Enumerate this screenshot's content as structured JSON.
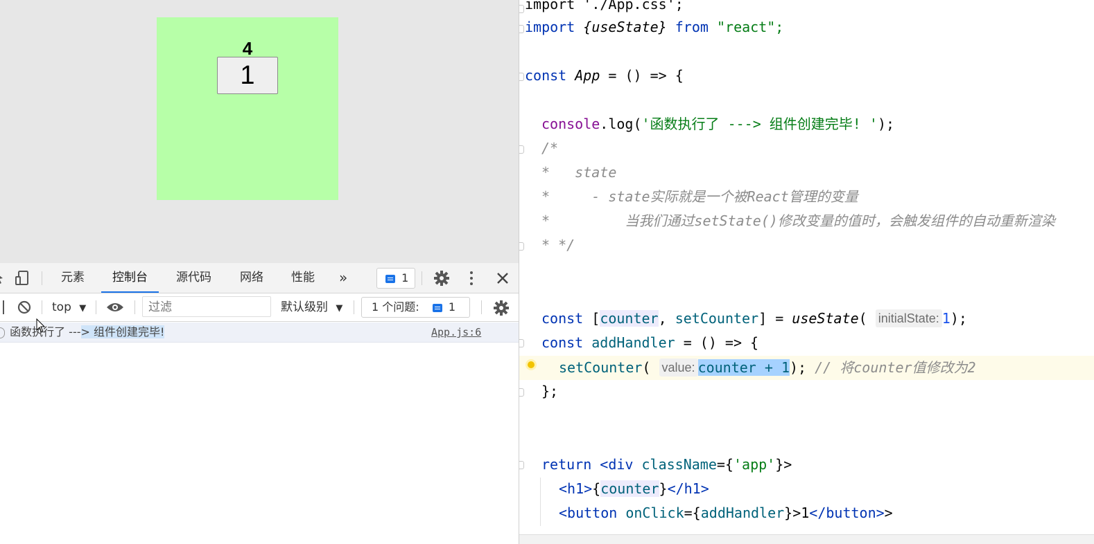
{
  "viewport": {
    "counter_text": "4",
    "button_label": "1"
  },
  "devtools": {
    "tabs": [
      "元素",
      "控制台",
      "源代码",
      "网络",
      "性能"
    ],
    "more_tabs": "»",
    "issues_badge_count": "1",
    "toolbar": {
      "context": "top",
      "filter_placeholder": "过滤",
      "level": "默认级别",
      "issues_label": "1 个问题:",
      "issues_count": "1"
    },
    "log": {
      "text_start": "函数执行了 ---",
      "text_highlight": "> 组件创建完毕!",
      "source": "App.js:6"
    }
  },
  "editor": {
    "line1": "import './App.css';",
    "line2_kw": "import",
    "line2_name": "{useState}",
    "line2_from": "from",
    "line2_str": "\"react\";",
    "const_kw": "const",
    "app_name": "App",
    "app_rest": " = () => {",
    "console": "console",
    "log": ".log(",
    "log_str": "'函数执行了 ---> 组件创建完毕! '",
    "log_end": ");",
    "c1": "/*",
    "c2": "*   state",
    "c3": "*     - state实际就是一个被React管理的变量",
    "c4": "*         当我们通过setState()修改变量的值时，会触发组件的自动重新渲染",
    "c5": "* */",
    "counter": "counter",
    "setCounter": "setCounter",
    "useState": "useState",
    "hint_initial": "initialState:",
    "one": "1",
    "addHandler": "addHandler",
    "arrow": " = () => {",
    "hint_value": "value:",
    "inc": "counter + 1",
    "comment_set": "// 将counter值修改为2",
    "close_brace": "};",
    "return_kw": "return",
    "div_open": "<div",
    "className": "className",
    "app_class": "'app'",
    "h1_open": "<h1>",
    "h1_close": "</h1>",
    "button_open": "<button",
    "onClick": "onClick",
    "button_text": "1",
    "button_close": "</button>"
  }
}
